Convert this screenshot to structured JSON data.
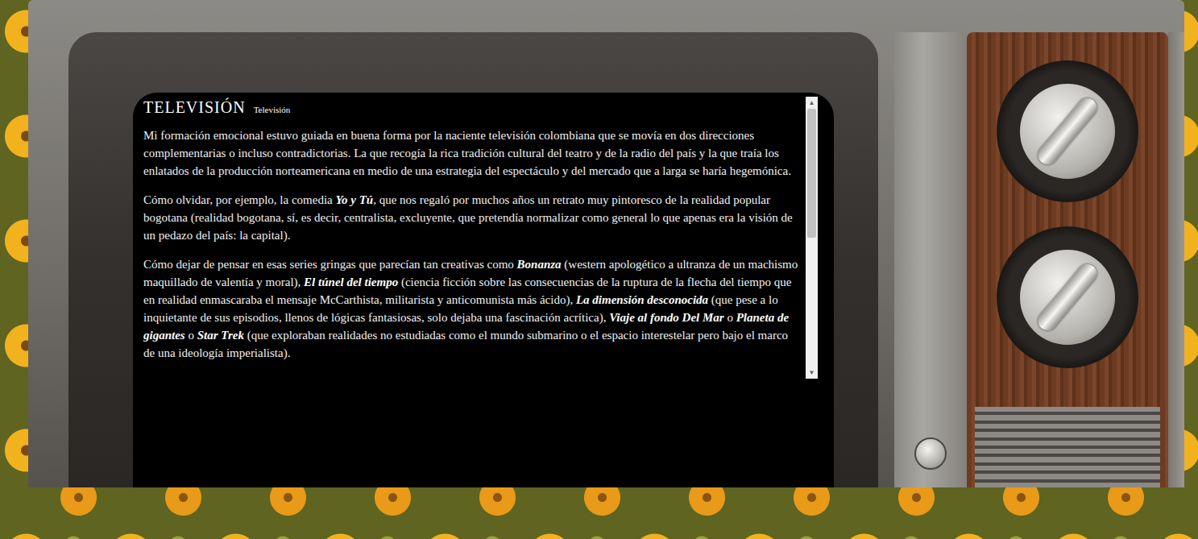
{
  "article": {
    "title": "TELEVISIÓN",
    "subtitle": "Televisión"
  },
  "paragraphs": [
    [
      {
        "text": "Mi formación emocional estuvo guiada en buena forma por la naciente televisión colombiana que se movía en dos direcciones complementarias o incluso contradictorias. La que recogía la rica tradición cultural del teatro y de la radio del país y la que traía los enlatados de la producción norteamericana en medio de una estrategia del espectáculo y del mercado que a larga se haría hegemónica.",
        "emphasis": false
      }
    ],
    [
      {
        "text": "Cómo olvidar, por ejemplo, la comedia ",
        "emphasis": false
      },
      {
        "text": "Yo y Tú",
        "emphasis": true
      },
      {
        "text": ", que nos regaló por muchos años un retrato muy pintoresco de la realidad popular bogotana (realidad bogotana, sí, es decir, centralista, excluyente, que pretendía normalizar como general lo que apenas era la visión de un pedazo del país: la capital).",
        "emphasis": false
      }
    ],
    [
      {
        "text": "Cómo dejar de pensar en esas series gringas que parecían tan creativas como ",
        "emphasis": false
      },
      {
        "text": "Bonanza",
        "emphasis": true
      },
      {
        "text": " (western apologético a ultranza de un machismo maquillado de valentía y moral), ",
        "emphasis": false
      },
      {
        "text": "El túnel del tiempo",
        "emphasis": true
      },
      {
        "text": " (ciencia ficción sobre las consecuencias de la ruptura de la flecha del tiempo que en realidad enmascaraba el mensaje McCarthista, militarista y anticomunista más ácido), ",
        "emphasis": false
      },
      {
        "text": "La dimensión desconocida",
        "emphasis": true
      },
      {
        "text": " (que pese a lo inquietante de sus episodios, llenos de lógicas fantasiosas, solo dejaba una fascinación acrítica), ",
        "emphasis": false
      },
      {
        "text": "Viaje al fondo Del Mar",
        "emphasis": true
      },
      {
        "text": " o ",
        "emphasis": false
      },
      {
        "text": "Planeta de gigantes",
        "emphasis": true
      },
      {
        "text": " o ",
        "emphasis": false
      },
      {
        "text": "Star Trek",
        "emphasis": true
      },
      {
        "text": " (que exploraban realidades no estudiadas como el mundo submarino o el espacio interestelar pero bajo el marco de una ideología imperialista).",
        "emphasis": false
      }
    ]
  ],
  "scrollbar": {
    "up": "▲",
    "down": "▼",
    "level": 0.5
  }
}
